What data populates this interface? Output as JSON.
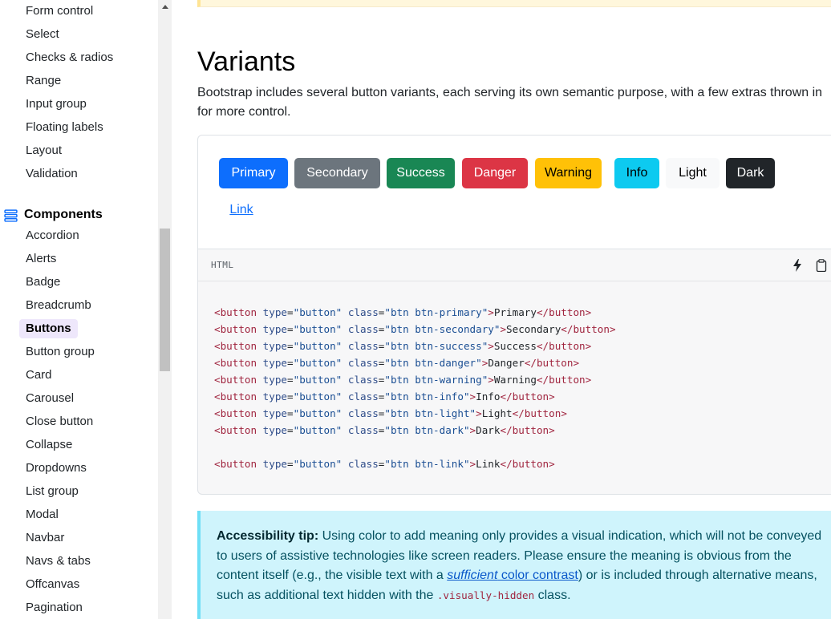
{
  "sidebar": {
    "forms_items": [
      "Form control",
      "Select",
      "Checks & radios",
      "Range",
      "Input group",
      "Floating labels",
      "Layout",
      "Validation"
    ],
    "group_label": "Components",
    "component_items": [
      "Accordion",
      "Alerts",
      "Badge",
      "Breadcrumb",
      "Buttons",
      "Button group",
      "Card",
      "Carousel",
      "Close button",
      "Collapse",
      "Dropdowns",
      "List group",
      "Modal",
      "Navbar",
      "Navs & tabs",
      "Offcanvas",
      "Pagination"
    ],
    "active_item": "Buttons",
    "icon_color": "#0d6efd"
  },
  "section": {
    "heading": "Variants",
    "intro": "Bootstrap includes several button variants, each serving its own semantic purpose, with a few extras thrown in for more control."
  },
  "buttons": [
    {
      "label": "Primary",
      "bg": "#0d6efd",
      "color": "#ffffff"
    },
    {
      "label": "Secondary",
      "bg": "#6c757d",
      "color": "#ffffff"
    },
    {
      "label": "Success",
      "bg": "#198754",
      "color": "#ffffff"
    },
    {
      "label": "Danger",
      "bg": "#dc3545",
      "color": "#ffffff"
    },
    {
      "label": "Warning",
      "bg": "#ffc107",
      "color": "#000000"
    },
    {
      "label": "Info",
      "bg": "#0dcaf0",
      "color": "#000000"
    },
    {
      "label": "Light",
      "bg": "#f8f9fa",
      "color": "#000000"
    },
    {
      "label": "Dark",
      "bg": "#212529",
      "color": "#ffffff"
    }
  ],
  "link_button": {
    "label": "Link",
    "color": "#0d6efd"
  },
  "code": {
    "language": "HTML",
    "actions": {
      "run": "lightning-icon",
      "copy": "clipboard-icon"
    },
    "lines": [
      {
        "cls": "btn btn-primary",
        "text": "Primary"
      },
      {
        "cls": "btn btn-secondary",
        "text": "Secondary"
      },
      {
        "cls": "btn btn-success",
        "text": "Success"
      },
      {
        "cls": "btn btn-danger",
        "text": "Danger"
      },
      {
        "cls": "btn btn-warning",
        "text": "Warning"
      },
      {
        "cls": "btn btn-info",
        "text": "Info"
      },
      {
        "cls": "btn btn-light",
        "text": "Light"
      },
      {
        "cls": "btn btn-dark",
        "text": "Dark"
      },
      {
        "cls": "btn btn-link",
        "text": "Link"
      }
    ]
  },
  "tip": {
    "strong": "Accessibility tip:",
    "text1": " Using color to add meaning only provides a visual indication, which will not be conveyed to users of assistive technologies like screen readers. Please ensure the meaning is obvious from the content itself (e.g., the visible text with a ",
    "link_em": "sufficient",
    "link_rest": " color contrast",
    "text2": ") or is included through alternative means, such as additional text hidden with the ",
    "code": ".visually-hidden",
    "text3": " class."
  }
}
